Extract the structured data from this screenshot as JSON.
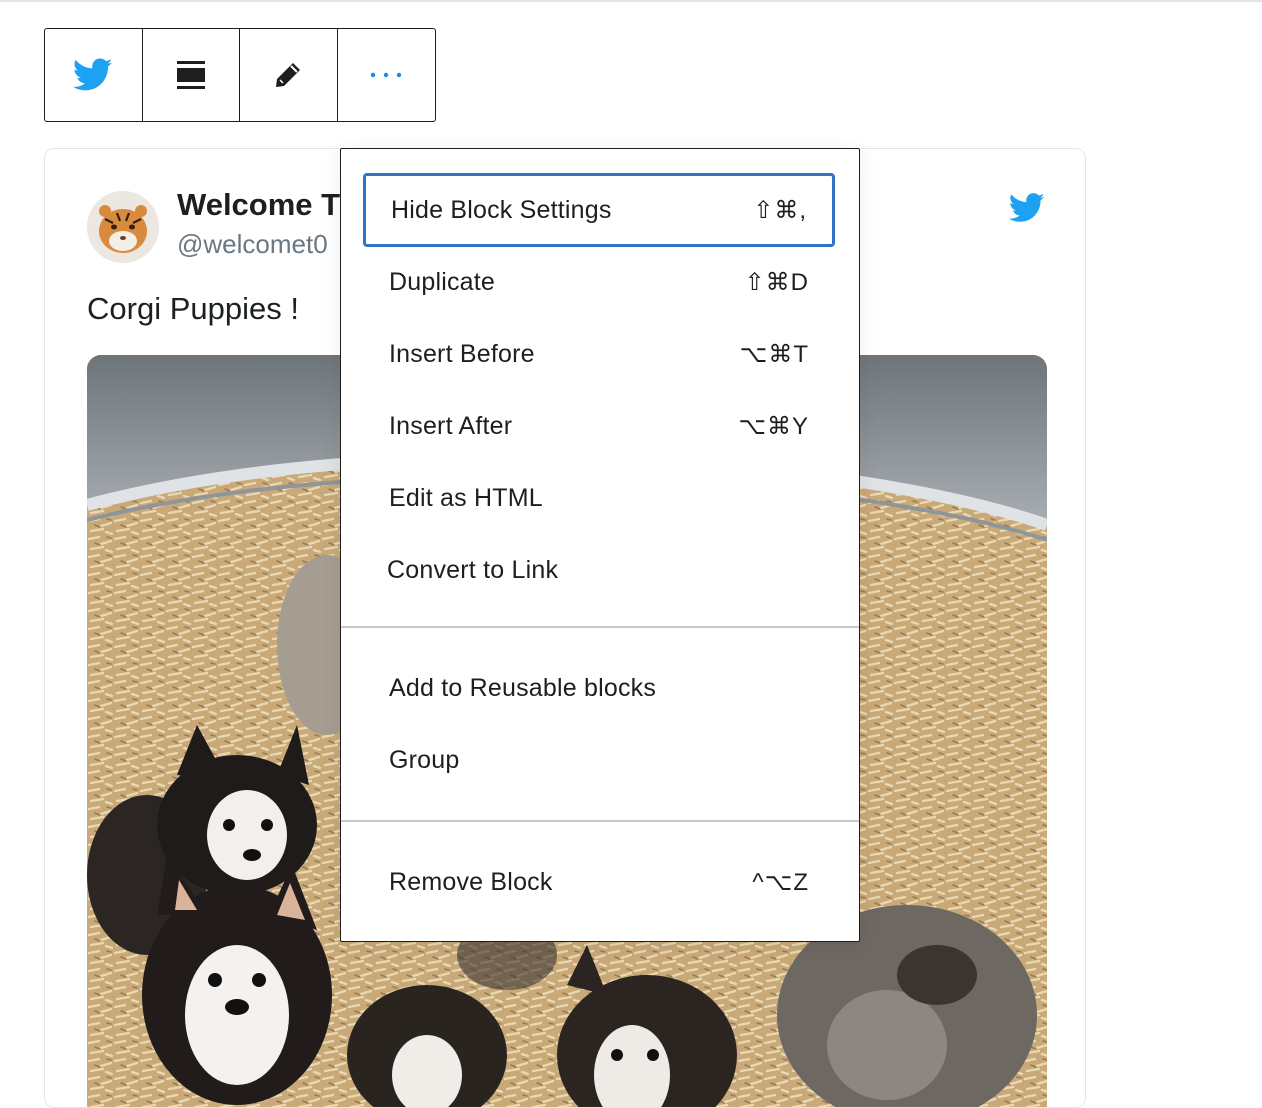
{
  "toolbar": {
    "buttons": [
      {
        "icon": "twitter-icon",
        "color": "#1da1f2"
      },
      {
        "icon": "align-icon"
      },
      {
        "icon": "pencil-icon"
      },
      {
        "icon": "more-options-icon",
        "color": "#1e88e5"
      }
    ]
  },
  "tweet": {
    "author_name": "Welcome T",
    "author_handle": "@welcomet0",
    "text": "Corgi Puppies !",
    "logo_icon": "twitter-icon",
    "accent_color": "#1da1f2"
  },
  "menu": {
    "items": [
      {
        "label": "Hide Block Settings",
        "shortcut": "⇧⌘,"
      },
      {
        "label": "Duplicate",
        "shortcut": "⇧⌘D"
      },
      {
        "label": "Insert Before",
        "shortcut": "⌥⌘T"
      },
      {
        "label": "Insert After",
        "shortcut": "⌥⌘Y"
      },
      {
        "label": "Edit as HTML",
        "shortcut": ""
      },
      {
        "label": "Convert to Link",
        "shortcut": ""
      },
      {
        "label": "Add to Reusable blocks",
        "shortcut": ""
      },
      {
        "label": "Group",
        "shortcut": ""
      },
      {
        "label": "Remove Block",
        "shortcut": "^⌥Z"
      }
    ],
    "focus_color": "#2d75c4"
  }
}
